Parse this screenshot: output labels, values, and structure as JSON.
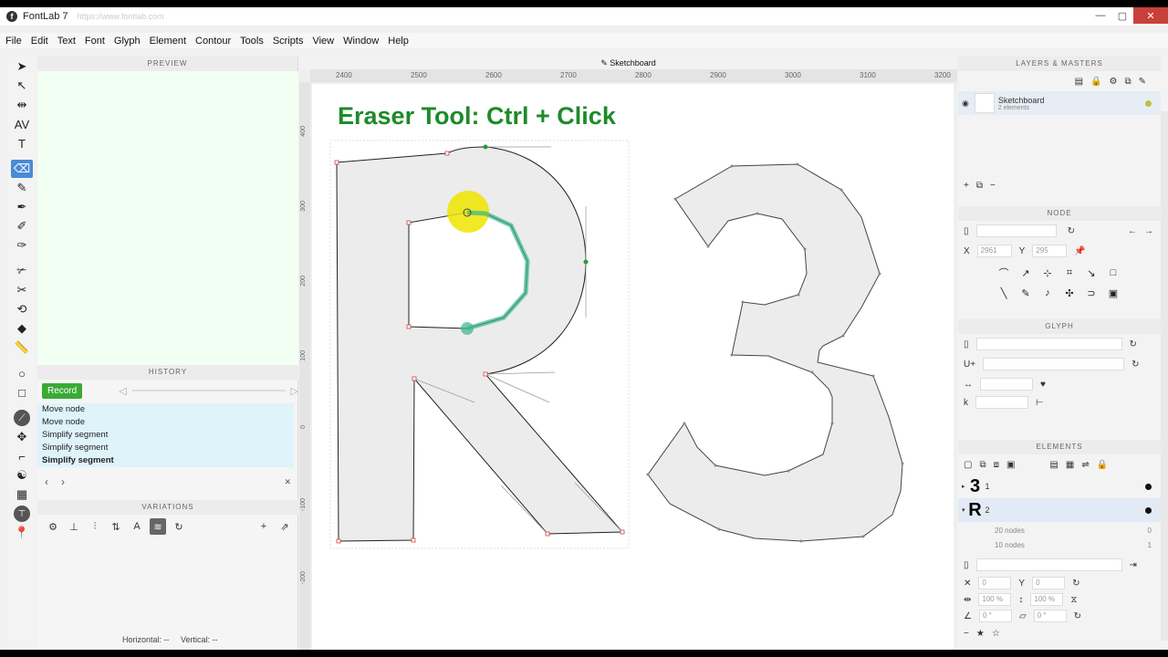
{
  "window": {
    "title": "FontLab 7",
    "url": "https://www.fontlab.com",
    "buttons": [
      "—",
      "▢",
      "✕"
    ]
  },
  "menu": [
    "File",
    "Edit",
    "Text",
    "Font",
    "Glyph",
    "Element",
    "Contour",
    "Tools",
    "Scripts",
    "View",
    "Window",
    "Help"
  ],
  "panels": {
    "preview": "PREVIEW",
    "history": "HISTORY",
    "variations": "VARIATIONS",
    "layers": "LAYERS & MASTERS",
    "node": "NODE",
    "glyph": "GLYPH",
    "elements": "ELEMENTS"
  },
  "history": {
    "record_label": "Record",
    "items": [
      "Move node",
      "Move node",
      "Simplify segment",
      "Simplify segment",
      "Simplify segment"
    ]
  },
  "status": {
    "horizontal": "Horizontal: --",
    "vertical": "Vertical: --"
  },
  "canvas": {
    "tab": "Sketchboard",
    "heading": "Eraser Tool: Ctrl + Click",
    "ruler_x": [
      "2400",
      "2500",
      "2600",
      "2700",
      "2800",
      "2900",
      "3000",
      "3100",
      "3200"
    ],
    "ruler_y": [
      "400",
      "300",
      "200",
      "100",
      "0",
      "-100",
      "-200"
    ]
  },
  "layers": {
    "name": "Sketchboard",
    "sub": "2 elements"
  },
  "node": {
    "x_label": "X",
    "x_value": "2961",
    "y_label": "Y",
    "y_value": "295"
  },
  "glyph": {
    "unicode_label": "U+"
  },
  "elements": {
    "rows": [
      {
        "glyph": "3",
        "label": "1"
      },
      {
        "glyph": "R",
        "label": "2"
      }
    ],
    "sub": [
      "20 nodes",
      "10 nodes"
    ],
    "sub_counts": [
      "0",
      "1"
    ],
    "transform": {
      "x": "0",
      "y": "0",
      "scale_x": "100 %",
      "scale_y": "100 %",
      "rot": "0 °",
      "slant": "0 °"
    }
  },
  "colors": {
    "accent": "#4a8bd4",
    "record": "#3aaa35",
    "heading": "#1e8a2a",
    "highlight": "#f0e500",
    "segment": "#3bb88f"
  }
}
